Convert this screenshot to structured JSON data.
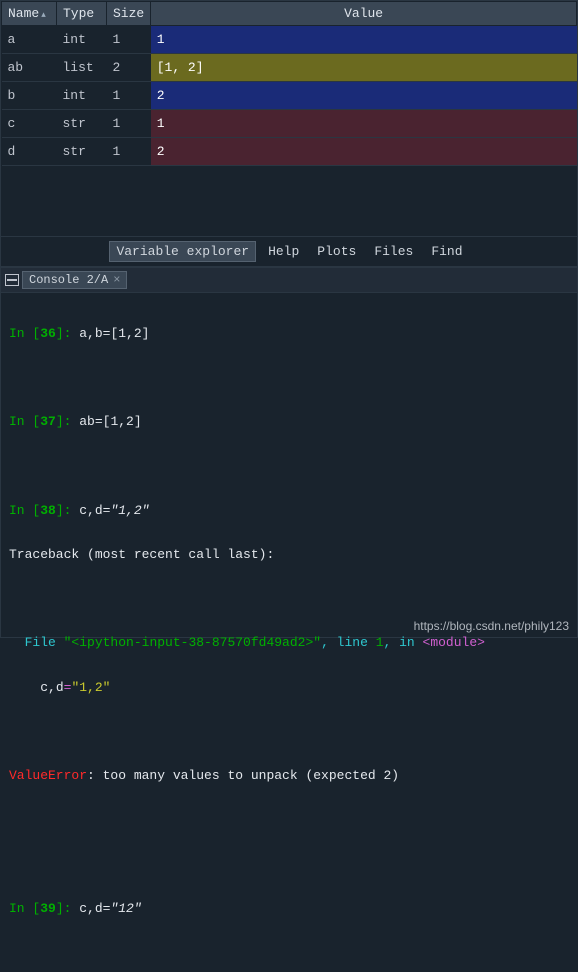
{
  "explorer": {
    "columns": {
      "name": "Name",
      "type": "Type",
      "size": "Size",
      "value": "Value"
    },
    "rows": [
      {
        "name": "a",
        "type": "int",
        "size": "1",
        "value": "1",
        "cls": "bg-navy"
      },
      {
        "name": "ab",
        "type": "list",
        "size": "2",
        "value": "[1, 2]",
        "cls": "bg-olive"
      },
      {
        "name": "b",
        "type": "int",
        "size": "1",
        "value": "2",
        "cls": "bg-navy"
      },
      {
        "name": "c",
        "type": "str",
        "size": "1",
        "value": "1",
        "cls": "bg-maroon"
      },
      {
        "name": "d",
        "type": "str",
        "size": "1",
        "value": "2",
        "cls": "bg-maroon"
      }
    ]
  },
  "pane_tabs": {
    "active": "Variable explorer",
    "others": [
      "Help",
      "Plots",
      "Files",
      "Find"
    ]
  },
  "console_tab": {
    "label": "Console 2/A",
    "close": "×"
  },
  "console": {
    "l1_prompt_a": "In [",
    "l1_num": "36",
    "l1_prompt_b": "]: ",
    "l1_code": "a,b=[1,2]",
    "l2_prompt_a": "In [",
    "l2_num": "37",
    "l2_prompt_b": "]: ",
    "l2_code": "ab=[1,2]",
    "l3_prompt_a": "In [",
    "l3_num": "38",
    "l3_prompt_b": "]: ",
    "l3_code_a": "c,d=",
    "l3_code_b": "\"1,2\"",
    "tb_head_a": "Traceback ",
    "tb_head_b": "(most recent call last)",
    "tb_head_c": ":",
    "tb_file_a": "  File ",
    "tb_file_b": "\"<ipython-input-38-87570fd49ad2>\"",
    "tb_file_c": ", line ",
    "tb_file_d": "1",
    "tb_file_e": ", in ",
    "tb_file_f": "<module>",
    "tb_src_a": "    c,d",
    "tb_src_b": "=",
    "tb_src_c": "\"1,2\"",
    "err_a": "ValueError",
    "err_b": ": ",
    "err_c": "too many values to unpack (expected 2)",
    "l4_prompt_a": "In [",
    "l4_num": "39",
    "l4_prompt_b": "]: ",
    "l4_code_a": "c,d=",
    "l4_code_b": "\"12\""
  },
  "footer": "https://blog.csdn.net/phily123"
}
